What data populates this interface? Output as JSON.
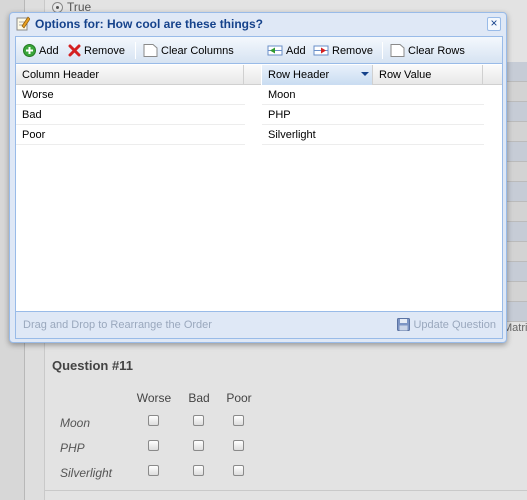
{
  "background": {
    "radio_label": "True",
    "matrix_label": "Matrix",
    "question_title": "Question #11",
    "column_headers": [
      "Worse",
      "Bad",
      "Poor"
    ],
    "row_labels": [
      "Moon",
      "PHP",
      "Silverlight"
    ]
  },
  "dialog": {
    "title": "Options for: How cool are these things?",
    "close_label": "×",
    "toolbar": {
      "add_col_label": "Add",
      "remove_col_label": "Remove",
      "clear_columns_label": "Clear Columns",
      "add_row_label": "Add",
      "remove_row_label": "Remove",
      "clear_rows_label": "Clear Rows"
    },
    "columns_grid": {
      "headers": [
        "Column Header"
      ],
      "rows": [
        "Worse",
        "Bad",
        "Poor"
      ]
    },
    "rows_grid": {
      "headers": [
        "Row Header",
        "Row Value"
      ],
      "rows": [
        {
          "header": "Moon",
          "value": ""
        },
        {
          "header": "PHP",
          "value": ""
        },
        {
          "header": "Silverlight",
          "value": ""
        }
      ]
    },
    "footer": {
      "hint": "Drag and Drop to Rearrange the Order",
      "update_label": "Update Question"
    }
  },
  "colors": {
    "dialog_border": "#99bbe8",
    "title_text": "#15428b",
    "disabled_text": "#9aa8bd"
  }
}
